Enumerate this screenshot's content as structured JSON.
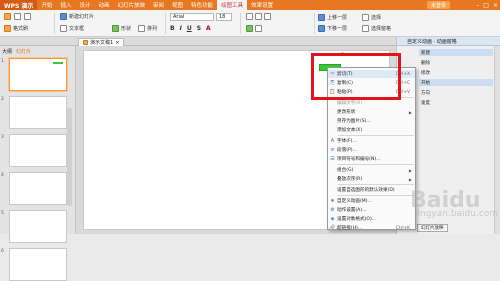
{
  "titlebar": {
    "app_button": "WPS 演示",
    "menu_tabs": [
      "开始",
      "插入",
      "设计",
      "动画",
      "幻灯片放映",
      "审阅",
      "视图",
      "特色功能",
      "绘图工具",
      "效果设置"
    ],
    "active_tab_index": 8,
    "user_badge": "未登录"
  },
  "ribbon": {
    "format_painter": "格式刷",
    "new_slide": "新建幻灯片",
    "text_box": "文本框",
    "shape": "形状",
    "arrange": "排列",
    "font_name": "Arial",
    "font_size": "18",
    "align_up": "上移一层",
    "align_down": "下移一层",
    "select": "选择",
    "select_pane": "选择窗格",
    "pane_title": "自定义动画"
  },
  "tabstrip": {
    "doc_tab": "演示文稿1"
  },
  "leftpanel": {
    "tabs": [
      "大纲",
      "幻灯片"
    ],
    "active_tab_index": 1,
    "thumb_numbers": [
      "1",
      "2",
      "3",
      "4",
      "5",
      "6"
    ]
  },
  "context_menu": {
    "items": [
      {
        "icon": "cut-icon",
        "glyph": "✂",
        "label": "剪切(T)",
        "shortcut": "Ctrl+X",
        "disabled": false
      },
      {
        "icon": "copy-icon",
        "glyph": "⎘",
        "label": "复制(C)",
        "shortcut": "Ctrl+C",
        "disabled": false
      },
      {
        "icon": "paste-icon",
        "glyph": "📋",
        "label": "粘贴(P)",
        "shortcut": "Ctrl+V",
        "disabled": false
      },
      {
        "icon": "",
        "glyph": "",
        "label": "编辑文字(X)",
        "shortcut": "",
        "disabled": true
      },
      {
        "icon": "",
        "glyph": "",
        "label": "更改形状",
        "shortcut": "",
        "disabled": false,
        "submenu": true
      },
      {
        "icon": "",
        "glyph": "",
        "label": "另存为图片(S)...",
        "shortcut": "",
        "disabled": false
      },
      {
        "icon": "",
        "glyph": "",
        "label": "添加文本(X)",
        "shortcut": "",
        "disabled": false
      },
      {
        "icon": "font-icon",
        "glyph": "A",
        "label": "字体(F)...",
        "shortcut": "",
        "disabled": false
      },
      {
        "icon": "paragraph-icon",
        "glyph": "≡",
        "label": "段落(P)...",
        "shortcut": "",
        "disabled": false
      },
      {
        "icon": "bullets-icon",
        "glyph": "☰",
        "label": "项目符号和编号(N)...",
        "shortcut": "",
        "disabled": false
      },
      {
        "icon": "",
        "glyph": "",
        "label": "组合(G)",
        "shortcut": "",
        "disabled": false,
        "submenu": true
      },
      {
        "icon": "",
        "glyph": "",
        "label": "叠放次序(R)",
        "shortcut": "",
        "disabled": false,
        "submenu": true
      },
      {
        "icon": "",
        "glyph": "",
        "label": "设置自选图形的默认效果(D)",
        "shortcut": "",
        "disabled": false
      },
      {
        "icon": "animation-icon",
        "glyph": "★",
        "label": "自定义动画(M)...",
        "shortcut": "",
        "disabled": false
      },
      {
        "icon": "action-icon",
        "glyph": "⚙",
        "label": "动作设置(A)...",
        "shortcut": "",
        "disabled": false
      },
      {
        "icon": "format-shape-icon",
        "glyph": "◈",
        "label": "设置对象格式(O)...",
        "shortcut": "",
        "disabled": false
      },
      {
        "icon": "hyperlink-icon",
        "glyph": "🔗",
        "label": "超链接(H)...",
        "shortcut": "Ctrl+K",
        "disabled": false
      }
    ]
  },
  "rightpane": {
    "header": "自定义动画 · 动画窗格",
    "rows": [
      "新建",
      "删除",
      "修改",
      "开始",
      "方向",
      "速度"
    ],
    "footer": "幻灯片放映"
  },
  "watermark": {
    "logo": "Baidu",
    "url": "jingyan.baidu.com"
  },
  "colors": {
    "accent": "#e87722",
    "selection_outline": "#e0141b",
    "shape_fill": "#33cc33"
  }
}
